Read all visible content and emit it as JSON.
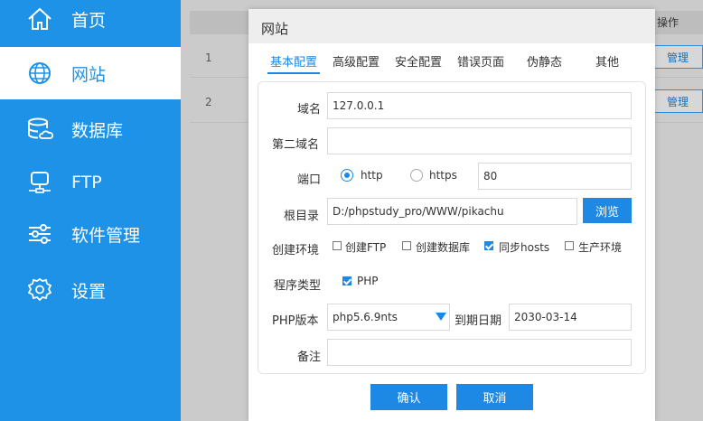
{
  "sidebar": {
    "items": [
      {
        "label": "首页",
        "icon": "home-icon"
      },
      {
        "label": "网站",
        "icon": "globe-icon"
      },
      {
        "label": "数据库",
        "icon": "database-icon"
      },
      {
        "label": "FTP",
        "icon": "server-icon"
      },
      {
        "label": "软件管理",
        "icon": "sliders-icon"
      },
      {
        "label": "设置",
        "icon": "gear-icon"
      }
    ],
    "active": "网站"
  },
  "table": {
    "header_op": "操作",
    "rows": [
      {
        "num": "1",
        "action": "管理"
      },
      {
        "num": "2",
        "action": "管理"
      }
    ]
  },
  "dialog": {
    "title": "网站",
    "tabs": [
      "基本配置",
      "高级配置",
      "安全配置",
      "错误页面",
      "伪静态",
      "其他"
    ],
    "active_tab": "基本配置",
    "form": {
      "domain_label": "域名",
      "domain_value": "127.0.0.1",
      "second_domain_label": "第二域名",
      "second_domain_value": "",
      "port_label": "端口",
      "protocol_http": "http",
      "protocol_https": "https",
      "protocol_selected": "http",
      "port_value": "80",
      "root_label": "根目录",
      "root_value": "D:/phpstudy_pro/WWW/pikachu",
      "browse_button": "浏览",
      "env_label": "创建环境",
      "env_options": [
        {
          "label": "创建FTP",
          "checked": false
        },
        {
          "label": "创建数据库",
          "checked": false
        },
        {
          "label": "同步hosts",
          "checked": true
        },
        {
          "label": "生产环境",
          "checked": false
        }
      ],
      "prog_label": "程序类型",
      "prog_option": "PHP",
      "prog_checked": true,
      "php_version_label": "PHP版本",
      "php_version_value": "php5.6.9nts",
      "expire_label": "到期日期",
      "expire_value": "2030-03-14",
      "note_label": "备注",
      "note_value": ""
    },
    "confirm_button": "确认",
    "cancel_button": "取消"
  },
  "colors": {
    "accent": "#1e88e5",
    "sidebar_bg": "#1e92e6"
  }
}
